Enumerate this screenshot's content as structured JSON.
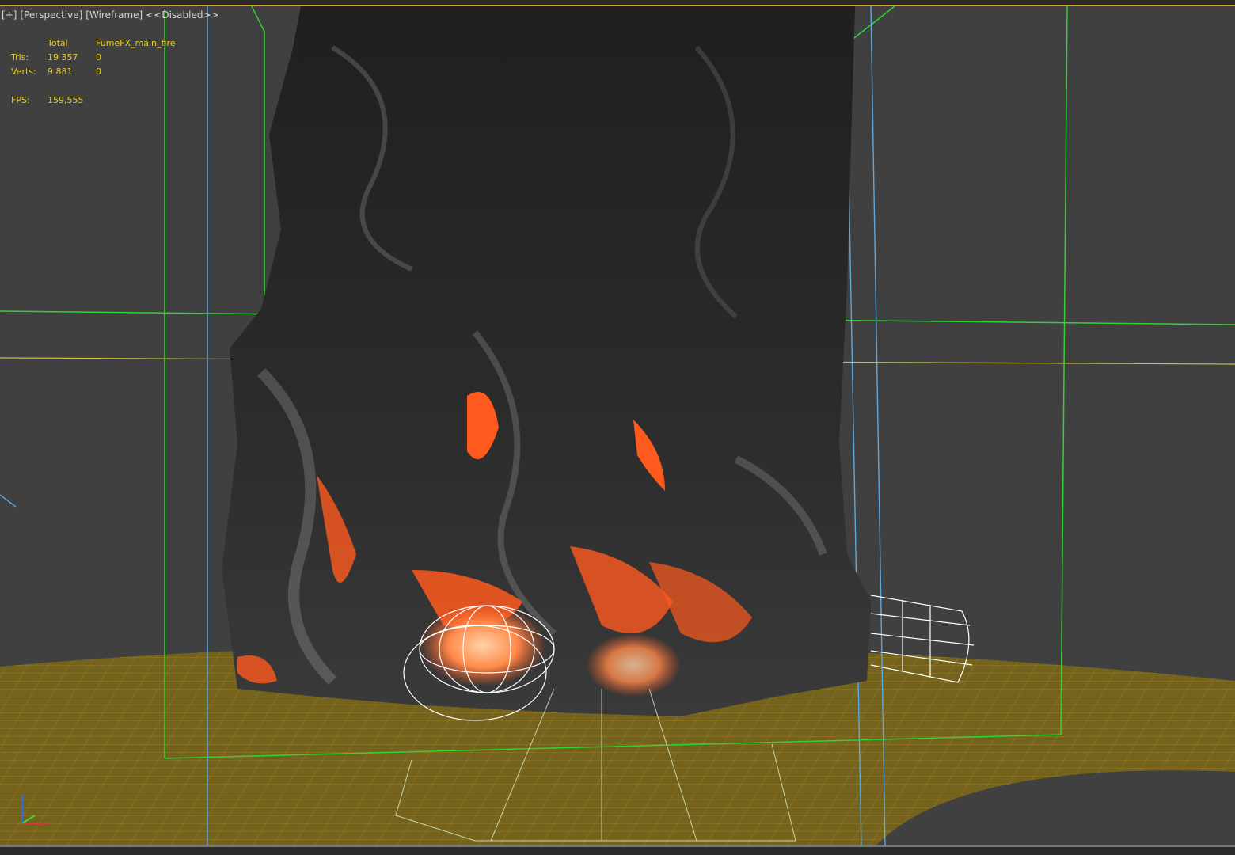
{
  "viewport": {
    "labels": {
      "plus": "[+]",
      "view": "[Perspective]",
      "shading": "[Wireframe]",
      "state": "<<Disabled>>"
    },
    "stats": {
      "header_total": "Total",
      "header_object": "FumeFX_main_fire",
      "tris_label": "Tris:",
      "tris_total": "19 357",
      "tris_object": "0",
      "verts_label": "Verts:",
      "verts_total": "9 881",
      "verts_object": "0",
      "fps_label": "FPS:",
      "fps_value": "159,555"
    }
  },
  "colors": {
    "background": "#404040",
    "stats_text": "#e4cc28",
    "fume_box": "#2fd42f",
    "camera_box": "#5ea8e0",
    "ground_grid": "#b8941c",
    "fire": "#ff5a1e",
    "smoke": "#2a2a2a"
  },
  "icons": [
    "axis-gizmo-icon",
    "emitter-cylinder-icon",
    "viewcube-edge-icon"
  ]
}
